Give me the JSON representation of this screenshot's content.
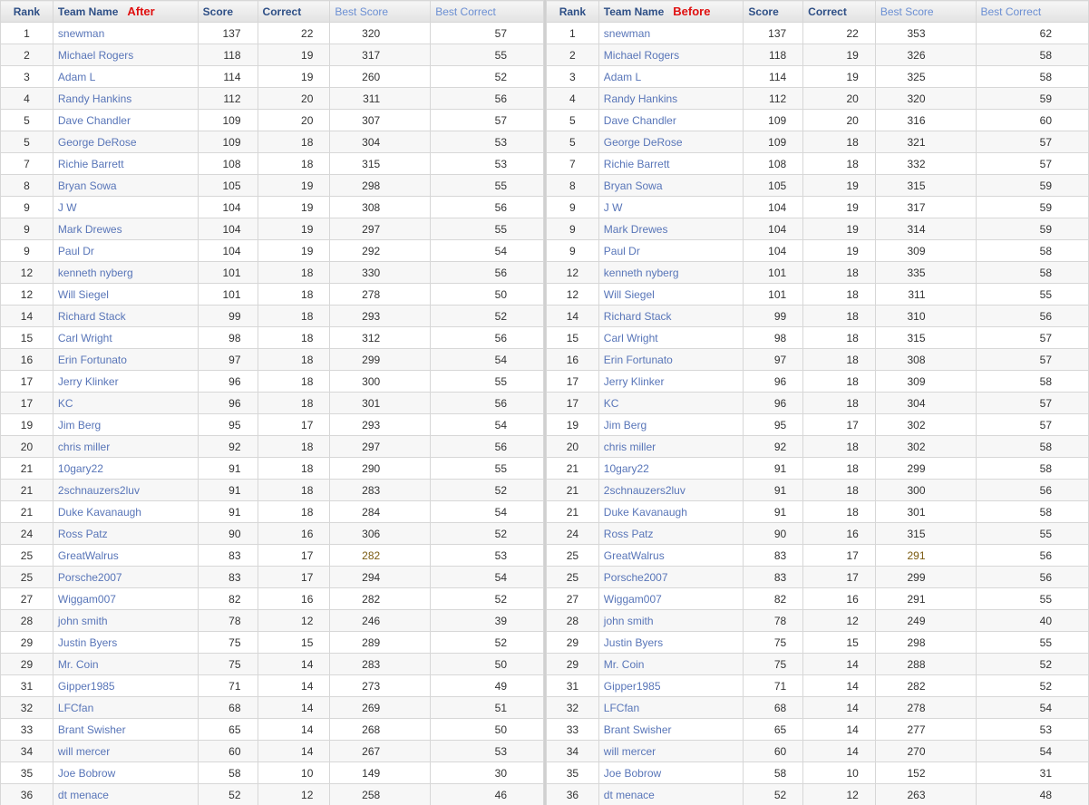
{
  "headers": {
    "rank": "Rank",
    "team_name": "Team Name",
    "score": "Score",
    "correct": "Correct",
    "best_score": "Best Score",
    "best_correct": "Best Correct"
  },
  "labels": {
    "after": "After",
    "before": "Before"
  },
  "colors": {
    "tag": "#e01010",
    "link": "#5875b8",
    "header_text": "#2e4f86",
    "best_header": "#6b8fd3"
  },
  "rows": [
    {
      "rank": "1",
      "name": "snewman",
      "score": "137",
      "correct": "22",
      "after_best_score": "320",
      "after_best_correct": "57",
      "before_best_score": "353",
      "before_best_correct": "62"
    },
    {
      "rank": "2",
      "name": "Michael Rogers",
      "score": "118",
      "correct": "19",
      "after_best_score": "317",
      "after_best_correct": "55",
      "before_best_score": "326",
      "before_best_correct": "58"
    },
    {
      "rank": "3",
      "name": "Adam L",
      "score": "114",
      "correct": "19",
      "after_best_score": "260",
      "after_best_correct": "52",
      "before_best_score": "325",
      "before_best_correct": "58"
    },
    {
      "rank": "4",
      "name": "Randy Hankins",
      "score": "112",
      "correct": "20",
      "after_best_score": "311",
      "after_best_correct": "56",
      "before_best_score": "320",
      "before_best_correct": "59"
    },
    {
      "rank": "5",
      "name": "Dave Chandler",
      "score": "109",
      "correct": "20",
      "after_best_score": "307",
      "after_best_correct": "57",
      "before_best_score": "316",
      "before_best_correct": "60"
    },
    {
      "rank": "5",
      "name": "George DeRose",
      "score": "109",
      "correct": "18",
      "after_best_score": "304",
      "after_best_correct": "53",
      "before_best_score": "321",
      "before_best_correct": "57"
    },
    {
      "rank": "7",
      "name": "Richie Barrett",
      "score": "108",
      "correct": "18",
      "after_best_score": "315",
      "after_best_correct": "53",
      "before_best_score": "332",
      "before_best_correct": "57"
    },
    {
      "rank": "8",
      "name": "Bryan Sowa",
      "score": "105",
      "correct": "19",
      "after_best_score": "298",
      "after_best_correct": "55",
      "before_best_score": "315",
      "before_best_correct": "59"
    },
    {
      "rank": "9",
      "name": "J W",
      "score": "104",
      "correct": "19",
      "after_best_score": "308",
      "after_best_correct": "56",
      "before_best_score": "317",
      "before_best_correct": "59"
    },
    {
      "rank": "9",
      "name": "Mark Drewes",
      "score": "104",
      "correct": "19",
      "after_best_score": "297",
      "after_best_correct": "55",
      "before_best_score": "314",
      "before_best_correct": "59"
    },
    {
      "rank": "9",
      "name": "Paul Dr",
      "score": "104",
      "correct": "19",
      "after_best_score": "292",
      "after_best_correct": "54",
      "before_best_score": "309",
      "before_best_correct": "58"
    },
    {
      "rank": "12",
      "name": "kenneth nyberg",
      "score": "101",
      "correct": "18",
      "after_best_score": "330",
      "after_best_correct": "56",
      "before_best_score": "335",
      "before_best_correct": "58"
    },
    {
      "rank": "12",
      "name": "Will Siegel",
      "score": "101",
      "correct": "18",
      "after_best_score": "278",
      "after_best_correct": "50",
      "before_best_score": "311",
      "before_best_correct": "55"
    },
    {
      "rank": "14",
      "name": "Richard Stack",
      "score": "99",
      "correct": "18",
      "after_best_score": "293",
      "after_best_correct": "52",
      "before_best_score": "310",
      "before_best_correct": "56"
    },
    {
      "rank": "15",
      "name": "Carl Wright",
      "score": "98",
      "correct": "18",
      "after_best_score": "312",
      "after_best_correct": "56",
      "before_best_score": "315",
      "before_best_correct": "57"
    },
    {
      "rank": "16",
      "name": "Erin Fortunato",
      "score": "97",
      "correct": "18",
      "after_best_score": "299",
      "after_best_correct": "54",
      "before_best_score": "308",
      "before_best_correct": "57"
    },
    {
      "rank": "17",
      "name": "Jerry Klinker",
      "score": "96",
      "correct": "18",
      "after_best_score": "300",
      "after_best_correct": "55",
      "before_best_score": "309",
      "before_best_correct": "58"
    },
    {
      "rank": "17",
      "name": "KC",
      "score": "96",
      "correct": "18",
      "after_best_score": "301",
      "after_best_correct": "56",
      "before_best_score": "304",
      "before_best_correct": "57"
    },
    {
      "rank": "19",
      "name": "Jim Berg",
      "score": "95",
      "correct": "17",
      "after_best_score": "293",
      "after_best_correct": "54",
      "before_best_score": "302",
      "before_best_correct": "57"
    },
    {
      "rank": "20",
      "name": "chris miller",
      "score": "92",
      "correct": "18",
      "after_best_score": "297",
      "after_best_correct": "56",
      "before_best_score": "302",
      "before_best_correct": "58"
    },
    {
      "rank": "21",
      "name": "10gary22",
      "score": "91",
      "correct": "18",
      "after_best_score": "290",
      "after_best_correct": "55",
      "before_best_score": "299",
      "before_best_correct": "58"
    },
    {
      "rank": "21",
      "name": "2schnauzers2luv",
      "score": "91",
      "correct": "18",
      "after_best_score": "283",
      "after_best_correct": "52",
      "before_best_score": "300",
      "before_best_correct": "56"
    },
    {
      "rank": "21",
      "name": "Duke Kavanaugh",
      "score": "91",
      "correct": "18",
      "after_best_score": "284",
      "after_best_correct": "54",
      "before_best_score": "301",
      "before_best_correct": "58"
    },
    {
      "rank": "24",
      "name": "Ross Patz",
      "score": "90",
      "correct": "16",
      "after_best_score": "306",
      "after_best_correct": "52",
      "before_best_score": "315",
      "before_best_correct": "55"
    },
    {
      "rank": "25",
      "name": "GreatWalrus",
      "score": "83",
      "correct": "17",
      "after_best_score": "282",
      "after_best_correct": "53",
      "before_best_score": "291",
      "before_best_correct": "56"
    },
    {
      "rank": "25",
      "name": "Porsche2007",
      "score": "83",
      "correct": "17",
      "after_best_score": "294",
      "after_best_correct": "54",
      "before_best_score": "299",
      "before_best_correct": "56"
    },
    {
      "rank": "27",
      "name": "Wiggam007",
      "score": "82",
      "correct": "16",
      "after_best_score": "282",
      "after_best_correct": "52",
      "before_best_score": "291",
      "before_best_correct": "55"
    },
    {
      "rank": "28",
      "name": "john smith",
      "score": "78",
      "correct": "12",
      "after_best_score": "246",
      "after_best_correct": "39",
      "before_best_score": "249",
      "before_best_correct": "40"
    },
    {
      "rank": "29",
      "name": "Justin Byers",
      "score": "75",
      "correct": "15",
      "after_best_score": "289",
      "after_best_correct": "52",
      "before_best_score": "298",
      "before_best_correct": "55"
    },
    {
      "rank": "29",
      "name": "Mr. Coin",
      "score": "75",
      "correct": "14",
      "after_best_score": "283",
      "after_best_correct": "50",
      "before_best_score": "288",
      "before_best_correct": "52"
    },
    {
      "rank": "31",
      "name": "Gipper1985",
      "score": "71",
      "correct": "14",
      "after_best_score": "273",
      "after_best_correct": "49",
      "before_best_score": "282",
      "before_best_correct": "52"
    },
    {
      "rank": "32",
      "name": "LFCfan",
      "score": "68",
      "correct": "14",
      "after_best_score": "269",
      "after_best_correct": "51",
      "before_best_score": "278",
      "before_best_correct": "54"
    },
    {
      "rank": "33",
      "name": "Brant Swisher",
      "score": "65",
      "correct": "14",
      "after_best_score": "268",
      "after_best_correct": "50",
      "before_best_score": "277",
      "before_best_correct": "53"
    },
    {
      "rank": "34",
      "name": "will mercer",
      "score": "60",
      "correct": "14",
      "after_best_score": "267",
      "after_best_correct": "53",
      "before_best_score": "270",
      "before_best_correct": "54"
    },
    {
      "rank": "35",
      "name": "Joe Bobrow",
      "score": "58",
      "correct": "10",
      "after_best_score": "149",
      "after_best_correct": "30",
      "before_best_score": "152",
      "before_best_correct": "31"
    },
    {
      "rank": "36",
      "name": "dt menace",
      "score": "52",
      "correct": "12",
      "after_best_score": "258",
      "after_best_correct": "46",
      "before_best_score": "263",
      "before_best_correct": "48"
    }
  ]
}
